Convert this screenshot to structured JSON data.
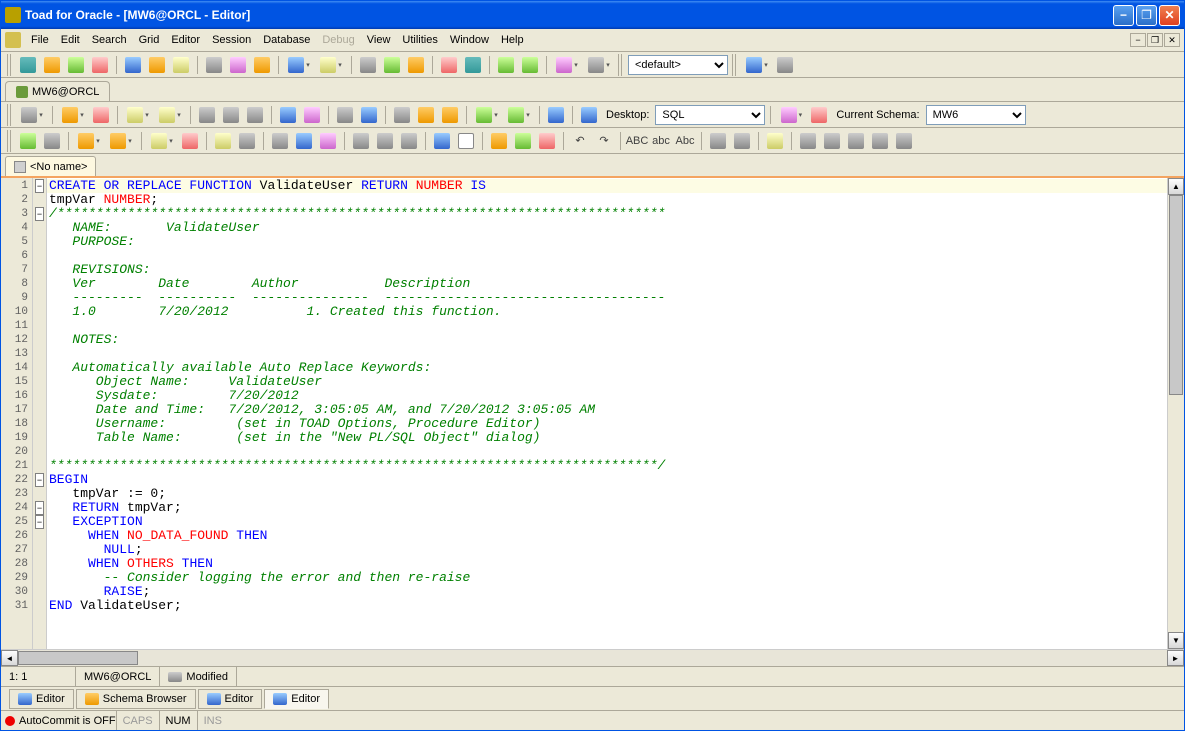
{
  "title": "Toad for Oracle - [MW6@ORCL - Editor]",
  "menus": [
    "File",
    "Edit",
    "Search",
    "Grid",
    "Editor",
    "Session",
    "Database",
    "Debug",
    "View",
    "Utilities",
    "Window",
    "Help"
  ],
  "menu_disabled": [
    "Debug"
  ],
  "conn_tab": "MW6@ORCL",
  "combos": {
    "default": "<default>",
    "desktop_label": "Desktop:",
    "desktop_value": "SQL",
    "schema_label": "Current Schema:",
    "schema_value": "MW6"
  },
  "doc_tab": "<No name>",
  "tb3_text": [
    "ABC",
    "abc",
    "Abc"
  ],
  "code_lines": [
    {
      "n": 1,
      "fold": "-",
      "seg": [
        {
          "t": "CREATE OR REPLACE FUNCTION",
          "c": "kw"
        },
        {
          "t": " ValidateUser ",
          "c": "ident"
        },
        {
          "t": "RETURN",
          "c": "kw"
        },
        {
          "t": " ",
          "c": "ident"
        },
        {
          "t": "NUMBER",
          "c": "kw2"
        },
        {
          "t": " ",
          "c": "ident"
        },
        {
          "t": "IS",
          "c": "kw"
        }
      ]
    },
    {
      "n": 2,
      "seg": [
        {
          "t": "tmpVar ",
          "c": "ident"
        },
        {
          "t": "NUMBER",
          "c": "kw2"
        },
        {
          "t": ";",
          "c": "ident"
        }
      ]
    },
    {
      "n": 3,
      "fold": "-",
      "seg": [
        {
          "t": "/******************************************************************************",
          "c": "com"
        }
      ]
    },
    {
      "n": 4,
      "seg": [
        {
          "t": "   NAME:       ValidateUser",
          "c": "com"
        }
      ]
    },
    {
      "n": 5,
      "seg": [
        {
          "t": "   PURPOSE:",
          "c": "com"
        }
      ]
    },
    {
      "n": 6,
      "seg": [
        {
          "t": "",
          "c": "com"
        }
      ]
    },
    {
      "n": 7,
      "seg": [
        {
          "t": "   REVISIONS:",
          "c": "com"
        }
      ]
    },
    {
      "n": 8,
      "seg": [
        {
          "t": "   Ver        Date        Author           Description",
          "c": "com"
        }
      ]
    },
    {
      "n": 9,
      "seg": [
        {
          "t": "   ---------  ----------  ---------------  ------------------------------------",
          "c": "com"
        }
      ]
    },
    {
      "n": 10,
      "seg": [
        {
          "t": "   1.0        7/20/2012          1. Created this function.",
          "c": "com"
        }
      ]
    },
    {
      "n": 11,
      "seg": [
        {
          "t": "",
          "c": "com"
        }
      ]
    },
    {
      "n": 12,
      "seg": [
        {
          "t": "   NOTES:",
          "c": "com"
        }
      ]
    },
    {
      "n": 13,
      "seg": [
        {
          "t": "",
          "c": "com"
        }
      ]
    },
    {
      "n": 14,
      "seg": [
        {
          "t": "   Automatically available Auto Replace Keywords:",
          "c": "com"
        }
      ]
    },
    {
      "n": 15,
      "seg": [
        {
          "t": "      Object Name:     ValidateUser",
          "c": "com"
        }
      ]
    },
    {
      "n": 16,
      "seg": [
        {
          "t": "      Sysdate:         7/20/2012",
          "c": "com"
        }
      ]
    },
    {
      "n": 17,
      "seg": [
        {
          "t": "      Date and Time:   7/20/2012, 3:05:05 AM, and 7/20/2012 3:05:05 AM",
          "c": "com"
        }
      ]
    },
    {
      "n": 18,
      "seg": [
        {
          "t": "      Username:         (set in TOAD Options, Procedure Editor)",
          "c": "com"
        }
      ]
    },
    {
      "n": 19,
      "seg": [
        {
          "t": "      Table Name:       (set in the \"New PL/SQL Object\" dialog)",
          "c": "com"
        }
      ]
    },
    {
      "n": 20,
      "seg": [
        {
          "t": "",
          "c": "com"
        }
      ]
    },
    {
      "n": 21,
      "seg": [
        {
          "t": "******************************************************************************/",
          "c": "com"
        }
      ]
    },
    {
      "n": 22,
      "fold": "-",
      "seg": [
        {
          "t": "BEGIN",
          "c": "kw"
        }
      ]
    },
    {
      "n": 23,
      "seg": [
        {
          "t": "   tmpVar := 0;",
          "c": "ident"
        }
      ]
    },
    {
      "n": 24,
      "fold": "-",
      "seg": [
        {
          "t": "   ",
          "c": "ident"
        },
        {
          "t": "RETURN",
          "c": "kw"
        },
        {
          "t": " tmpVar;",
          "c": "ident"
        }
      ]
    },
    {
      "n": 25,
      "fold": "-",
      "seg": [
        {
          "t": "   ",
          "c": "ident"
        },
        {
          "t": "EXCEPTION",
          "c": "kw"
        }
      ]
    },
    {
      "n": 26,
      "seg": [
        {
          "t": "     ",
          "c": "ident"
        },
        {
          "t": "WHEN",
          "c": "kw"
        },
        {
          "t": " ",
          "c": "ident"
        },
        {
          "t": "NO_DATA_FOUND",
          "c": "kw2"
        },
        {
          "t": " ",
          "c": "ident"
        },
        {
          "t": "THEN",
          "c": "kw"
        }
      ]
    },
    {
      "n": 27,
      "seg": [
        {
          "t": "       ",
          "c": "ident"
        },
        {
          "t": "NULL",
          "c": "kw"
        },
        {
          "t": ";",
          "c": "ident"
        }
      ]
    },
    {
      "n": 28,
      "seg": [
        {
          "t": "     ",
          "c": "ident"
        },
        {
          "t": "WHEN",
          "c": "kw"
        },
        {
          "t": " ",
          "c": "ident"
        },
        {
          "t": "OTHERS",
          "c": "kw2"
        },
        {
          "t": " ",
          "c": "ident"
        },
        {
          "t": "THEN",
          "c": "kw"
        }
      ]
    },
    {
      "n": 29,
      "seg": [
        {
          "t": "       ",
          "c": "ident"
        },
        {
          "t": "-- Consider logging the error and then re-raise",
          "c": "com"
        }
      ]
    },
    {
      "n": 30,
      "seg": [
        {
          "t": "       ",
          "c": "ident"
        },
        {
          "t": "RAISE",
          "c": "kw"
        },
        {
          "t": ";",
          "c": "ident"
        }
      ]
    },
    {
      "n": 31,
      "seg": [
        {
          "t": "END",
          "c": "kw"
        },
        {
          "t": " ValidateUser;",
          "c": "ident"
        }
      ]
    }
  ],
  "status": {
    "pos": "1: 1",
    "conn": "MW6@ORCL",
    "state": "Modified"
  },
  "bottom_tabs": [
    "Editor",
    "Schema Browser",
    "Editor",
    "Editor"
  ],
  "bottom_active": 3,
  "footer": {
    "autocommit": "AutoCommit is OFF",
    "caps": "CAPS",
    "num": "NUM",
    "ins": "INS"
  }
}
